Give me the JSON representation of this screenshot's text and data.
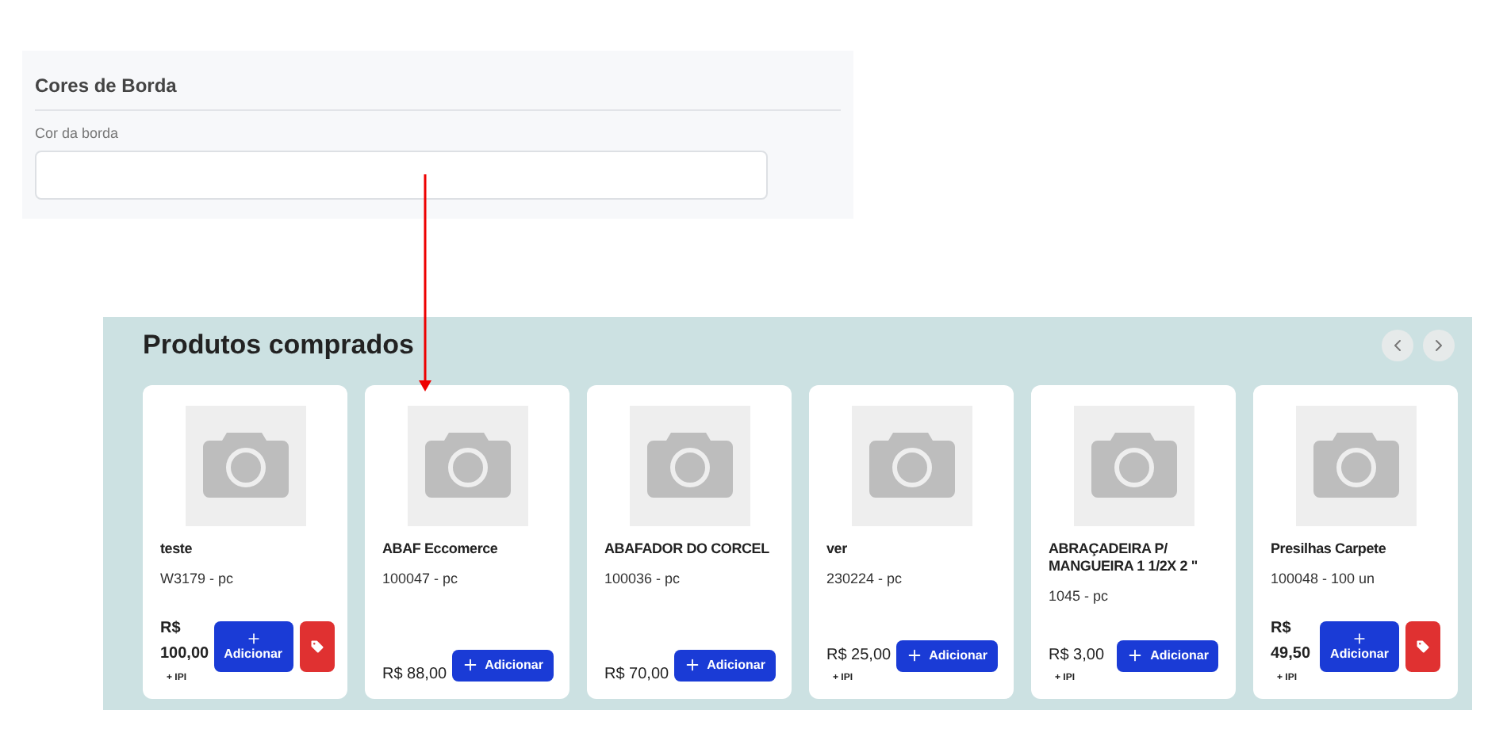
{
  "border_colors": {
    "title": "Cores de Borda",
    "field_label": "Cor da borda"
  },
  "products_section": {
    "title": "Produtos comprados",
    "products": [
      {
        "kind": "with-tag",
        "name": "teste",
        "code": "W3179 - pc",
        "price": "R$ 100,00",
        "ipi": "+ IPI",
        "button": "Adicionar"
      },
      {
        "kind": "plain",
        "name": "ABAF Eccomerce",
        "code": "100047 - pc",
        "price": "R$ 88,00",
        "button": "Adicionar"
      },
      {
        "kind": "plain",
        "name": "ABAFADOR DO CORCEL",
        "code": "100036 - pc",
        "price": "R$ 70,00",
        "button": "Adicionar"
      },
      {
        "kind": "plain",
        "name": "ver",
        "code": "230224 - pc",
        "price": "R$ 25,00",
        "ipi": "+ IPI",
        "button": "Adicionar"
      },
      {
        "kind": "plain",
        "name": "ABRAÇADEIRA P/ MANGUEIRA 1 1/2X 2 \"",
        "code": "1045 - pc",
        "price": "R$ 3,00",
        "ipi": "+ IPI",
        "button": "Adicionar"
      },
      {
        "kind": "with-tag",
        "name": "Presilhas Carpete",
        "code": "100048 - 100 un",
        "price": "R$ 49,50",
        "ipi": "+ IPI",
        "button": "Adicionar"
      }
    ]
  }
}
